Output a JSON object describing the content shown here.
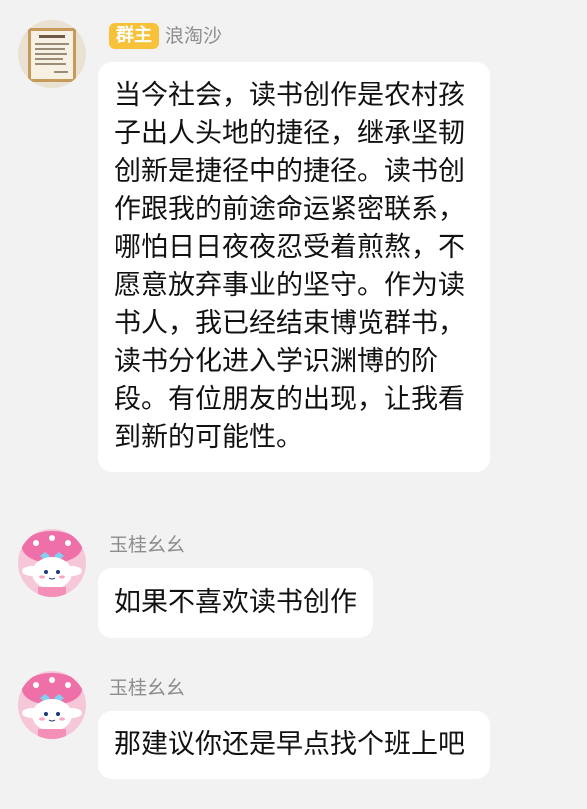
{
  "messages": [
    {
      "sender": "浪淘沙",
      "role_badge": "群主",
      "avatar_icon": "framed-certificate-avatar",
      "text": "当今社会，读书创作是农村孩子出人头地的捷径，继承坚韧创新是捷径中的捷径。读书创作跟我的前途命运紧密联系，哪怕日日夜夜忍受着煎熬，不愿意放弃事业的坚守。作为读书人，我已经结束博览群书，读书分化进入学识渊博的阶段。有位朋友的出现，让我看到新的可能性。"
    },
    {
      "sender": "玉桂幺幺",
      "role_badge": "",
      "avatar_icon": "cinnamoroll-pink-hat-avatar",
      "text": "如果不喜欢读书创作"
    },
    {
      "sender": "玉桂幺幺",
      "role_badge": "",
      "avatar_icon": "cinnamoroll-pink-hat-avatar",
      "text": "那建议你还是早点找个班上吧"
    }
  ],
  "colors": {
    "background": "#f2f2f2",
    "bubble": "#ffffff",
    "badge": "#f7c23a",
    "name_text": "#8d8d8d",
    "message_text": "#111111"
  }
}
